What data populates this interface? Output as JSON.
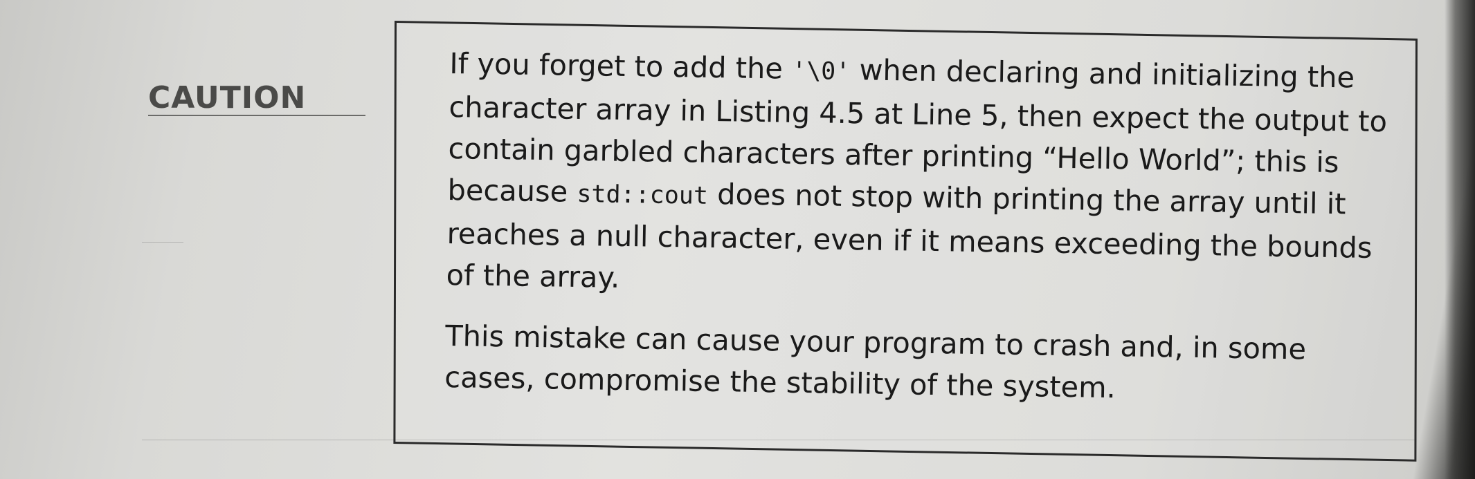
{
  "caution": {
    "label": "CAUTION",
    "paragraph1": {
      "part1": "If you forget to add the ",
      "code1": "'\\0'",
      "part2": " when declaring and initializing the character array in Listing 4.5 at Line 5, then expect the output to contain garbled characters after printing “Hello World”; this is because ",
      "code2": "std::cout",
      "part3": " does not stop with printing the array until it reaches a null character, even if it means exceeding the bounds of the array."
    },
    "paragraph2": "This mistake can cause your program to crash and, in some cases, compromise the stability of the system."
  }
}
